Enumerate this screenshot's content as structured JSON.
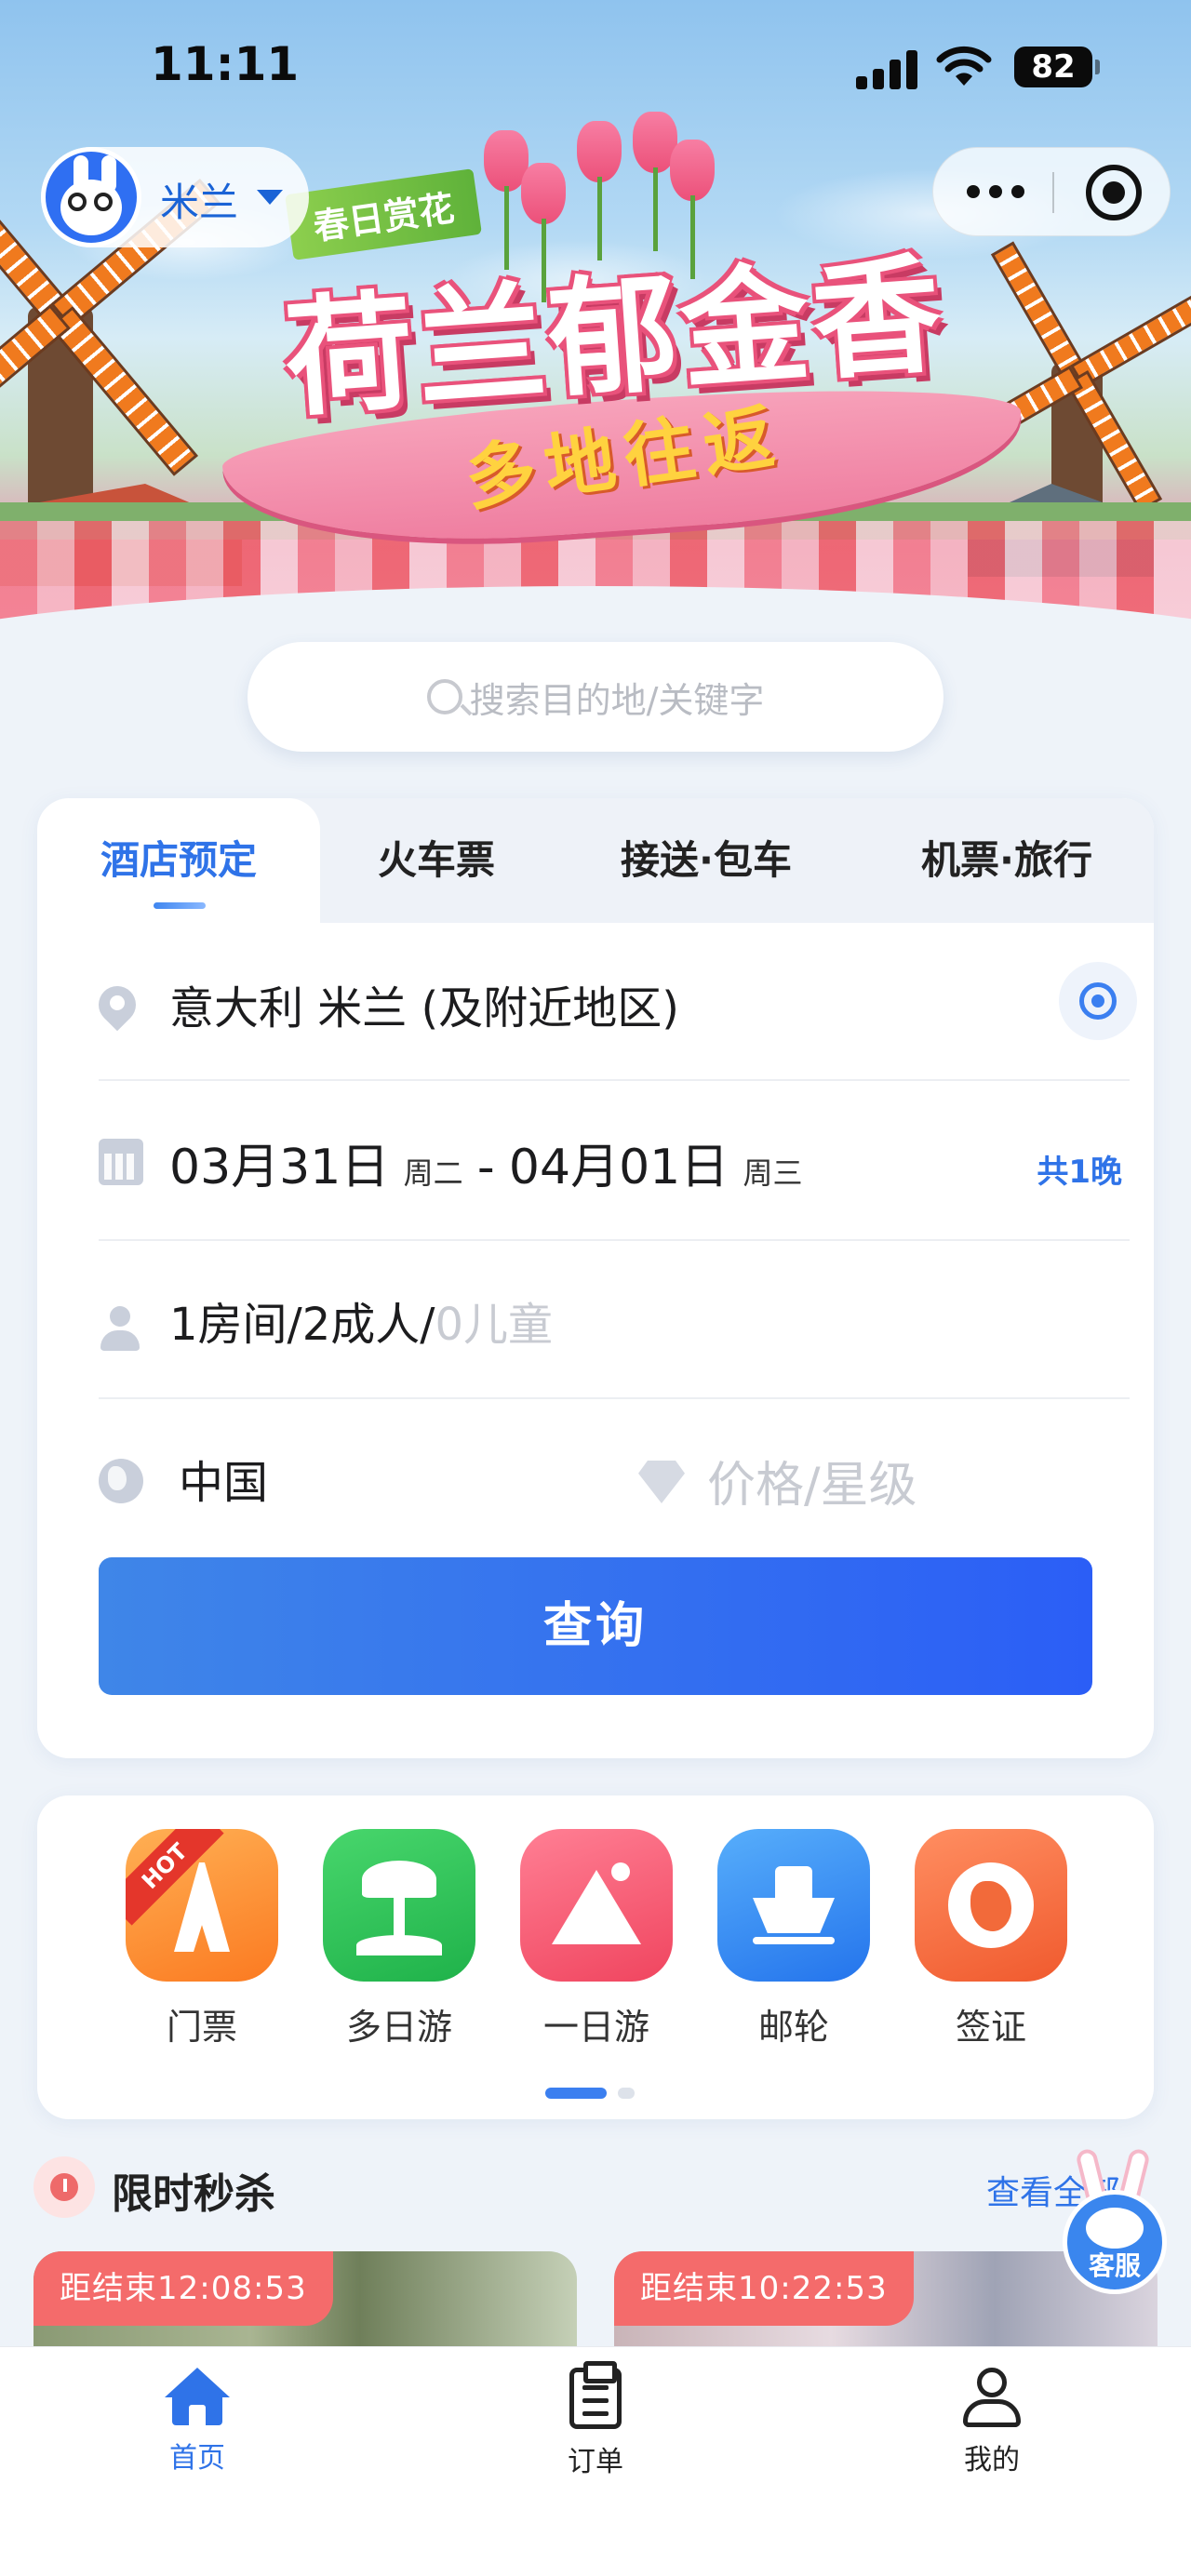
{
  "status_bar": {
    "time": "11:11",
    "battery": "82"
  },
  "banner": {
    "tag": "春日赏花",
    "title": "荷兰郁金香",
    "subtitle": "多地往返"
  },
  "header": {
    "city": "米兰"
  },
  "search": {
    "placeholder": "搜索目的地/关键字"
  },
  "booking": {
    "tabs": [
      {
        "label": "酒店预定",
        "active": true
      },
      {
        "label": "火车票",
        "active": false
      },
      {
        "label": "接送·包车",
        "active": false
      },
      {
        "label": "机票·旅行",
        "active": false
      }
    ],
    "destination": "意大利 米兰 (及附近地区)",
    "checkin_date": "03月31日",
    "checkin_week": "周二",
    "date_separator": "-",
    "checkout_date": "04月01日",
    "checkout_week": "周三",
    "nights": "共1晚",
    "rooms_adults": "1房间/2成人/",
    "children": "0儿童",
    "nationality": "中国",
    "price_placeholder": "价格/星级",
    "query_button": "查询"
  },
  "quick_links": [
    {
      "label": "门票",
      "icon": "ticket-tower-icon",
      "badge": "HOT"
    },
    {
      "label": "多日游",
      "icon": "palm-tree-icon"
    },
    {
      "label": "一日游",
      "icon": "mountain-icon"
    },
    {
      "label": "邮轮",
      "icon": "cruise-ship-icon"
    },
    {
      "label": "签证",
      "icon": "globe-visa-icon"
    }
  ],
  "pager": {
    "pages": 2,
    "active": 0
  },
  "flash_sale": {
    "title": "限时秒杀",
    "view_all": "查看全部",
    "deals": [
      {
        "countdown": "距结束12:08:53"
      },
      {
        "countdown": "距结束10:22:53"
      }
    ]
  },
  "service": {
    "label": "客服"
  },
  "bottom_nav": [
    {
      "label": "首页",
      "icon": "home-icon",
      "active": true
    },
    {
      "label": "订单",
      "icon": "order-clipboard-icon",
      "active": false
    },
    {
      "label": "我的",
      "icon": "profile-icon",
      "active": false
    }
  ],
  "colors": {
    "accent": "#2f73e8",
    "countdown": "#f46b6b",
    "query_start": "#3f86e8",
    "query_end": "#2b5ef6"
  }
}
